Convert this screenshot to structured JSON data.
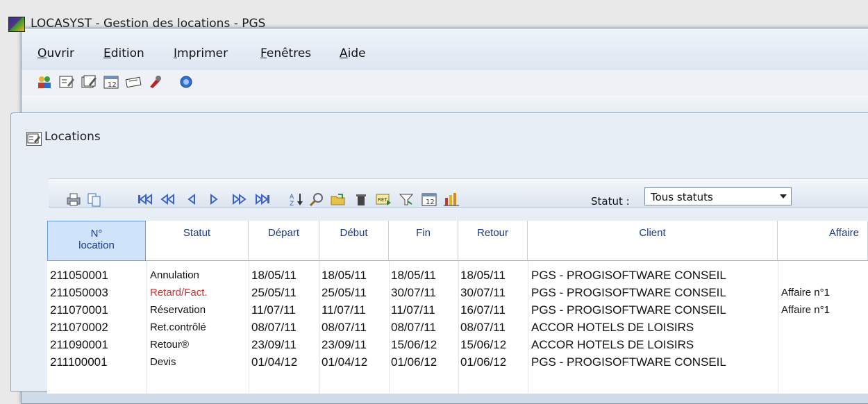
{
  "window": {
    "title": "LOCASYST - Gestion des locations - PGS"
  },
  "menu": {
    "items": [
      {
        "first": "O",
        "rest": "uvrir"
      },
      {
        "first": "E",
        "rest": "dition"
      },
      {
        "first": "I",
        "rest": "mprimer"
      },
      {
        "first": "F",
        "rest": "enêtres"
      },
      {
        "first": "A",
        "rest": "ide"
      }
    ]
  },
  "toolbar_icons": [
    "users-icon",
    "edit-form-icon",
    "edit-list-icon",
    "calendar-icon",
    "ticket-icon",
    "tools-icon",
    "help-icon"
  ],
  "locations": {
    "title": "Locations",
    "toolbar_icons": [
      "print-icon",
      "copy-icon",
      "first-icon",
      "prev-page-icon",
      "prev-icon",
      "next-icon",
      "next-page-icon",
      "last-icon",
      "sort-icon",
      "search-icon",
      "open-folder-icon",
      "delete-icon",
      "ret-icon",
      "filter-icon",
      "calendar-icon",
      "chart-icon"
    ],
    "statut_label": "Statut :",
    "statut_value": "Tous statuts",
    "columns": [
      {
        "label1": "N°",
        "label2": "location"
      },
      {
        "label1": "Statut",
        "label2": ""
      },
      {
        "label1": "Départ",
        "label2": ""
      },
      {
        "label1": "Début",
        "label2": ""
      },
      {
        "label1": "Fin",
        "label2": ""
      },
      {
        "label1": "Retour",
        "label2": ""
      },
      {
        "label1": "Client",
        "label2": ""
      },
      {
        "label1": "Affaire",
        "label2": ""
      }
    ],
    "rows": [
      {
        "num": "211050001",
        "statut": "Annulation",
        "depart": "18/05/11",
        "debut": "18/05/11",
        "fin": "18/05/11",
        "retour": "18/05/11",
        "client": "PGS - PROGISOFTWARE CONSEIL",
        "affaire": ""
      },
      {
        "num": "211050003",
        "statut": "Retard/Fact.",
        "depart": "25/05/11",
        "debut": "25/05/11",
        "fin": "30/07/11",
        "retour": "30/07/11",
        "client": "PGS - PROGISOFTWARE CONSEIL",
        "affaire": "Affaire n°1"
      },
      {
        "num": "211070001",
        "statut": "Réservation",
        "depart": "11/07/11",
        "debut": "11/07/11",
        "fin": "11/07/11",
        "retour": "16/07/11",
        "client": "PGS - PROGISOFTWARE CONSEIL",
        "affaire": "Affaire n°1"
      },
      {
        "num": "211070002",
        "statut": "Ret.contrôlé",
        "depart": "08/07/11",
        "debut": "08/07/11",
        "fin": "08/07/11",
        "retour": "08/07/11",
        "client": "ACCOR HOTELS DE LOISIRS",
        "affaire": ""
      },
      {
        "num": "211090001",
        "statut": "Retour®",
        "depart": "23/09/11",
        "debut": "23/09/11",
        "fin": "15/06/12",
        "retour": "15/06/12",
        "client": "ACCOR HOTELS DE LOISIRS",
        "affaire": ""
      },
      {
        "num": "211100001",
        "statut": "Devis",
        "depart": "01/04/12",
        "debut": "01/04/12",
        "fin": "01/06/12",
        "retour": "01/06/12",
        "client": "PGS - PROGISOFTWARE CONSEIL",
        "affaire": ""
      }
    ],
    "colors": {
      "header_text": "#1c3a8c",
      "late_status": "#d03030",
      "active_header_bg": "#cfe3fb"
    }
  }
}
